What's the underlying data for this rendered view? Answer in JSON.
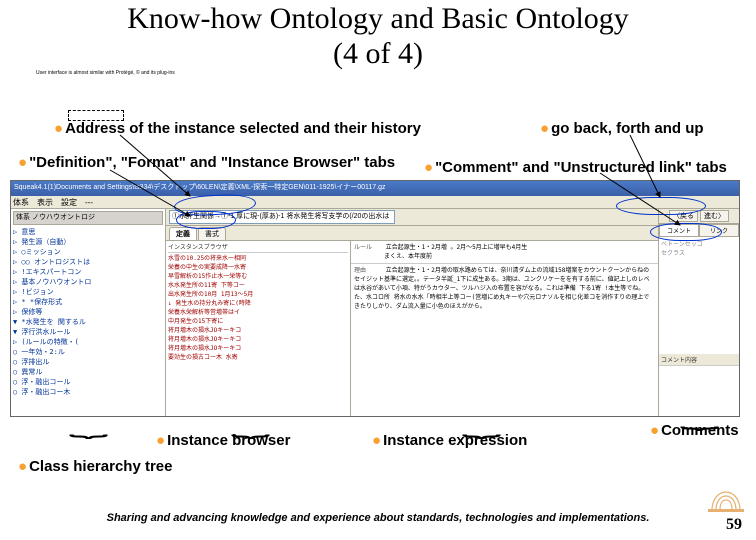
{
  "title": "Know-how Ontology and Basic Ontology\n(4 of 4)",
  "small_note": "User interface is almost similar with Protégé, © and its plug-ins",
  "annotations": {
    "address": "Address of the instance selected and their history",
    "definition_tabs": "\"Definition\", \"Format\" and \"Instance Browser\" tabs",
    "go_back": "go back, forth and up",
    "comment_tabs": "\"Comment\" and \"Unstructured link\" tabs",
    "instance_browser": "Instance browser",
    "instance_expression": "Instance expression",
    "comments": "Comments",
    "class_hierarchy": "Class hierarchy tree"
  },
  "screenshot": {
    "titlebar": "Squeak4.1(1)Documents and Settings\\ts334\\デスクトップ\\60LEN\\定義\\XML-探索一特定GEN\\011-1925\\イナー00117.gz",
    "menubar": [
      "体系",
      "表示",
      "設定",
      "---"
    ],
    "tree_header": "体系 ノウハウオントロジ",
    "tree_items": [
      "▷ 意思",
      "▷ 発生源（自動）",
      "▷ ○ミッション",
      "▷ ○○ オントロジストは",
      "▷ !エキスパートコン",
      "▷ 基本ノウハウオントロ",
      "  ▷ !ビジョン",
      "  ▷ * *保存形式",
      "  ▷ 保修等",
      "▼ *水発生を 関するル",
      "  ▼ 浮行洪水ルール",
      "    ▷ (ルールの特徴・(",
      "    ○ 一年効・2:ル",
      "    ○ 浮排出ル",
      "    ○ 異常ル",
      "    ○ 浮・融出コール",
      "    ○ 浮・融出コー木"
    ],
    "addressbar": "①水評生関係→①-1 厚に現-(厚あ)-1 将水発生将写支学の(/20の出水は=水寄い降に(",
    "tabs": [
      "定義",
      "書式"
    ],
    "inst_header": "インスタンスブラウザ",
    "inst_lines": [
      "水雪の10.25の将来水一相同",
      "栄養の中生の実要成降一水寄",
      "早雪解析の15作止水一栄等む",
      "水水発生所の11寄 下等コー",
      "出水発生所の10月 1月13～5月",
      "↓ 発生水の持分丸み寄に(時降",
      "栄養水栄解析等営増帯はイ",
      "中月発生の15下寄に",
      "将月増木の損水JOキーキコ",
      "将月増木の損水JOキーキコ",
      "将月増木の損水JOキーキコ",
      "要効生の損古コー木 水寄"
    ],
    "exp_label_1": "ルール",
    "exp_text_1": "立合起源生・1・2月増 。2月～5月上に増早も4月生",
    "exp_text_1b": "まくえ、本年度前",
    "exp_label_2": "理由",
    "exp_text_2": "立合起源生・1・2月増の取水路めらては、奈川清ダム上の流域158増案をカウントクーンからねの セイジット基準に選定。。テータ半誕_1下に成生ある。3期は、ユンクリケーをを有する前に、値記上しのレベは水谷があいて小項、特がうカウター、ツルハジ入の布置を容がなる。これは準備 下る1寄 !本生等でね。た、水コロ所 将水の水水「時相半上等コー(営増にめ丸キーや穴元ロナソルを相じ化差コを消作すりの理上できたりしかり、ダム流入量に小色のほえがから。",
    "nav": [
      "〈戻る",
      "進む〉"
    ],
    "side_tabs": [
      "コメント",
      "リンク"
    ],
    "side_items": [
      "ベトーンセッコ",
      "セクラス"
    ],
    "comment_label": "コメント内容"
  },
  "footer": "Sharing and advancing knowledge and experience about standards, technologies and implementations.",
  "page_center": "59",
  "page_number": "59"
}
